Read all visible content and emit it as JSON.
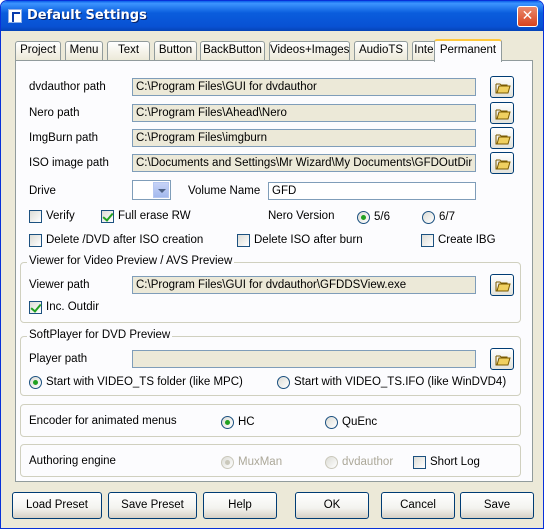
{
  "window": {
    "title": "Default Settings",
    "close_glyph": "✕"
  },
  "tabs": [
    {
      "label": "Project"
    },
    {
      "label": "Menu"
    },
    {
      "label": "Text"
    },
    {
      "label": "Button"
    },
    {
      "label": "BackButton"
    },
    {
      "label": "Videos+Images"
    },
    {
      "label": "AudioTS"
    },
    {
      "label": "Intern"
    },
    {
      "label": "Permanent",
      "active": true
    }
  ],
  "paths": {
    "dvdauthor": {
      "label": "dvdauthor path",
      "value": "C:\\Program Files\\GUI for dvdauthor"
    },
    "nero": {
      "label": "Nero path",
      "value": "C:\\Program Files\\Ahead\\Nero"
    },
    "imgburn": {
      "label": "ImgBurn path",
      "value": "C:\\Program Files\\imgburn"
    },
    "iso": {
      "label": "ISO image path",
      "value": "C:\\Documents and Settings\\Mr Wizard\\My Documents\\GFDOutDir"
    }
  },
  "drive": {
    "label": "Drive",
    "value": ""
  },
  "volume": {
    "label": "Volume Name",
    "value": "GFD"
  },
  "options": {
    "verify": {
      "label": "Verify",
      "checked": false
    },
    "full_erase": {
      "label": "Full erase RW",
      "checked": true
    },
    "nero_version_label": "Nero Version",
    "nero_56": {
      "label": "5/6",
      "selected": true
    },
    "nero_67": {
      "label": "6/7",
      "selected": false
    },
    "delete_dvd": {
      "label": "Delete /DVD after ISO creation",
      "checked": false
    },
    "delete_iso": {
      "label": "Delete ISO after burn",
      "checked": false
    },
    "create_ibg": {
      "label": "Create IBG",
      "checked": false
    }
  },
  "viewer": {
    "group_title": "Viewer for Video Preview / AVS Preview",
    "path_label": "Viewer path",
    "path_value": "C:\\Program Files\\GUI for dvdauthor\\GFDDSView.exe",
    "inc_outdir": {
      "label": "Inc. Outdir",
      "checked": true
    }
  },
  "softplayer": {
    "group_title": "SoftPlayer for DVD Preview",
    "path_label": "Player path",
    "path_value": "",
    "start_folder": {
      "label": "Start with VIDEO_TS folder (like MPC)",
      "selected": true
    },
    "start_ifo": {
      "label": "Start with VIDEO_TS.IFO (like WinDVD4)",
      "selected": false
    }
  },
  "encoder": {
    "label": "Encoder for animated menus",
    "hc": {
      "label": "HC",
      "selected": true
    },
    "quenc": {
      "label": "QuEnc",
      "selected": false
    }
  },
  "authoring": {
    "label": "Authoring engine",
    "muxman": {
      "label": "MuxMan",
      "selected": true,
      "enabled": false
    },
    "dvdauthor": {
      "label": "dvdauthor",
      "selected": false,
      "enabled": false
    },
    "short_log": {
      "label": "Short Log",
      "checked": false
    }
  },
  "buttons": {
    "load_preset": "Load Preset",
    "save_preset": "Save Preset",
    "help": "Help",
    "ok": "OK",
    "cancel": "Cancel",
    "save": "Save"
  }
}
